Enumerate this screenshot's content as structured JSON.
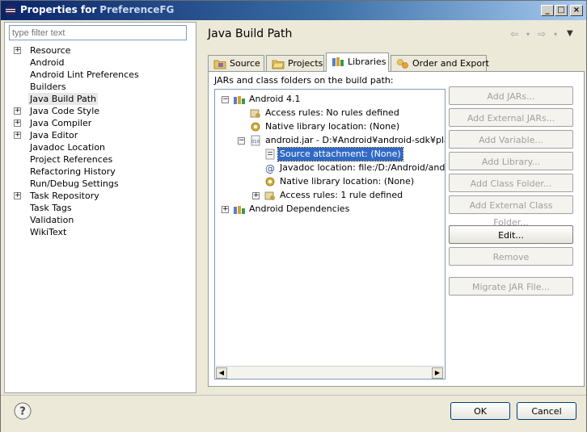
{
  "window": {
    "title_prefix": "Properties for",
    "title_name": "PreferenceFG",
    "controls": [
      "minimize",
      "maximize",
      "close"
    ]
  },
  "filter": {
    "placeholder": "type filter text"
  },
  "nav": {
    "items": [
      {
        "label": "Resource",
        "expandable": true
      },
      {
        "label": "Android",
        "expandable": false
      },
      {
        "label": "Android Lint Preferences",
        "expandable": false
      },
      {
        "label": "Builders",
        "expandable": false
      },
      {
        "label": "Java Build Path",
        "expandable": false,
        "selected": true
      },
      {
        "label": "Java Code Style",
        "expandable": true
      },
      {
        "label": "Java Compiler",
        "expandable": true
      },
      {
        "label": "Java Editor",
        "expandable": true
      },
      {
        "label": "Javadoc Location",
        "expandable": false
      },
      {
        "label": "Project References",
        "expandable": false
      },
      {
        "label": "Refactoring History",
        "expandable": false
      },
      {
        "label": "Run/Debug Settings",
        "expandable": false
      },
      {
        "label": "Task Repository",
        "expandable": true
      },
      {
        "label": "Task Tags",
        "expandable": false
      },
      {
        "label": "Validation",
        "expandable": false
      },
      {
        "label": "WikiText",
        "expandable": false
      }
    ]
  },
  "page": {
    "title": "Java Build Path"
  },
  "tabs": [
    {
      "label": "Source",
      "icon": "source-folder-icon"
    },
    {
      "label": "Projects",
      "icon": "projects-folder-icon"
    },
    {
      "label": "Libraries",
      "icon": "library-icon",
      "active": true
    },
    {
      "label": "Order and Export",
      "icon": "order-export-icon"
    }
  ],
  "libraries": {
    "caption": "JARs and class folders on the build path:",
    "tree": [
      {
        "label": "Android 4.1",
        "level": 0,
        "expander": "minus",
        "icon": "library-icon"
      },
      {
        "label": "Access rules: No rules defined",
        "level": 1,
        "expander": "none",
        "icon": "access-rules-icon"
      },
      {
        "label": "Native library location: (None)",
        "level": 1,
        "expander": "none",
        "icon": "native-library-icon"
      },
      {
        "label": "android.jar - D:¥Android¥android-sdk¥platfo",
        "level": 1,
        "expander": "minus",
        "icon": "jar-icon"
      },
      {
        "label": "Source attachment: (None)",
        "level": 2,
        "expander": "none",
        "icon": "source-attachment-icon",
        "selected": true
      },
      {
        "label": "Javadoc location: file:/D:/Android/andro",
        "level": 2,
        "expander": "none",
        "icon": "javadoc-icon"
      },
      {
        "label": "Native library location: (None)",
        "level": 2,
        "expander": "none",
        "icon": "native-library-icon"
      },
      {
        "label": "Access rules: 1 rule defined",
        "level": 2,
        "expander": "plus",
        "icon": "access-rules-icon"
      },
      {
        "label": "Android Dependencies",
        "level": 0,
        "expander": "plus",
        "icon": "library-icon"
      }
    ]
  },
  "buttons": {
    "add_jars": "Add JARs...",
    "add_external_jars": "Add External JARs...",
    "add_variable": "Add Variable...",
    "add_library": "Add Library...",
    "add_class_folder": "Add Class Folder...",
    "add_external_class_folder": "Add External Class Folder...",
    "edit": "Edit...",
    "remove": "Remove",
    "migrate_jar": "Migrate JAR File..."
  },
  "footer": {
    "ok": "OK",
    "cancel": "Cancel"
  }
}
